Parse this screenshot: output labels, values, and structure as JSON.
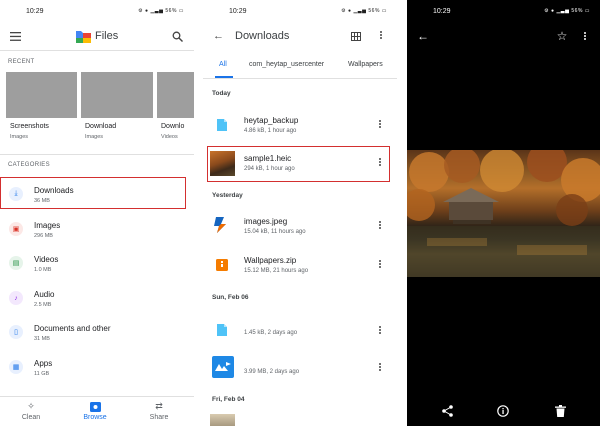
{
  "panel1": {
    "status": {
      "time": "10:29",
      "icons": "⚙ ● ▁▃▅ 56% ▭"
    },
    "app_title": "Files",
    "recent_label": "RECENT",
    "recent": [
      {
        "name": "Screenshots",
        "sub": "Images"
      },
      {
        "name": "Download",
        "sub": "Images"
      },
      {
        "name": "Downlo",
        "sub": "Videos"
      }
    ],
    "categories_label": "CATEGORIES",
    "categories": [
      {
        "name": "Downloads",
        "size": "36 MB",
        "icon": "download-icon",
        "color": "#1a73e8",
        "bg": "#e8f0fe"
      },
      {
        "name": "Images",
        "size": "296 MB",
        "icon": "image-icon",
        "color": "#d93025",
        "bg": "#fce8e6"
      },
      {
        "name": "Videos",
        "size": "1.0 MB",
        "icon": "video-icon",
        "color": "#1e8e3e",
        "bg": "#e6f4ea"
      },
      {
        "name": "Audio",
        "size": "2.5 MB",
        "icon": "audio-icon",
        "color": "#9334e6",
        "bg": "#f3e8fd"
      },
      {
        "name": "Documents and other",
        "size": "31 MB",
        "icon": "document-icon",
        "color": "#1a73e8",
        "bg": "#e8f0fe"
      },
      {
        "name": "Apps",
        "size": "11 GB",
        "icon": "apps-icon",
        "color": "#1a73e8",
        "bg": "#e8f0fe"
      }
    ],
    "nav": {
      "clean": "Clean",
      "browse": "Browse",
      "share": "Share"
    }
  },
  "panel2": {
    "status": {
      "time": "10:29",
      "icons": "⚙ ● ▁▃▅ 56% ▭"
    },
    "title": "Downloads",
    "tabs": [
      "All",
      "com_heytap_usercenter",
      "Wallpapers"
    ],
    "sections": {
      "today": "Today",
      "yesterday": "Yesterday",
      "sun": "Sun, Feb 06",
      "fri": "Fri, Feb 04"
    },
    "files": [
      {
        "name": "heytap_backup",
        "meta": "4.86 kB, 1 hour ago"
      },
      {
        "name": "sample1.heic",
        "meta": "294 kB, 1 hour ago"
      },
      {
        "name": "images.jpeg",
        "meta": "15.04 kB, 11 hours ago"
      },
      {
        "name": "Wallpapers.zip",
        "meta": "15.12 MB, 21 hours ago"
      },
      {
        "name": "",
        "meta": "1.45 kB, 2 days ago"
      },
      {
        "name": "",
        "meta": "3.99 MB, 2 days ago"
      }
    ]
  },
  "panel3": {
    "status": {
      "time": "10:29",
      "icons": "⚙ ● ▁▃▅ 56% ▭"
    }
  }
}
